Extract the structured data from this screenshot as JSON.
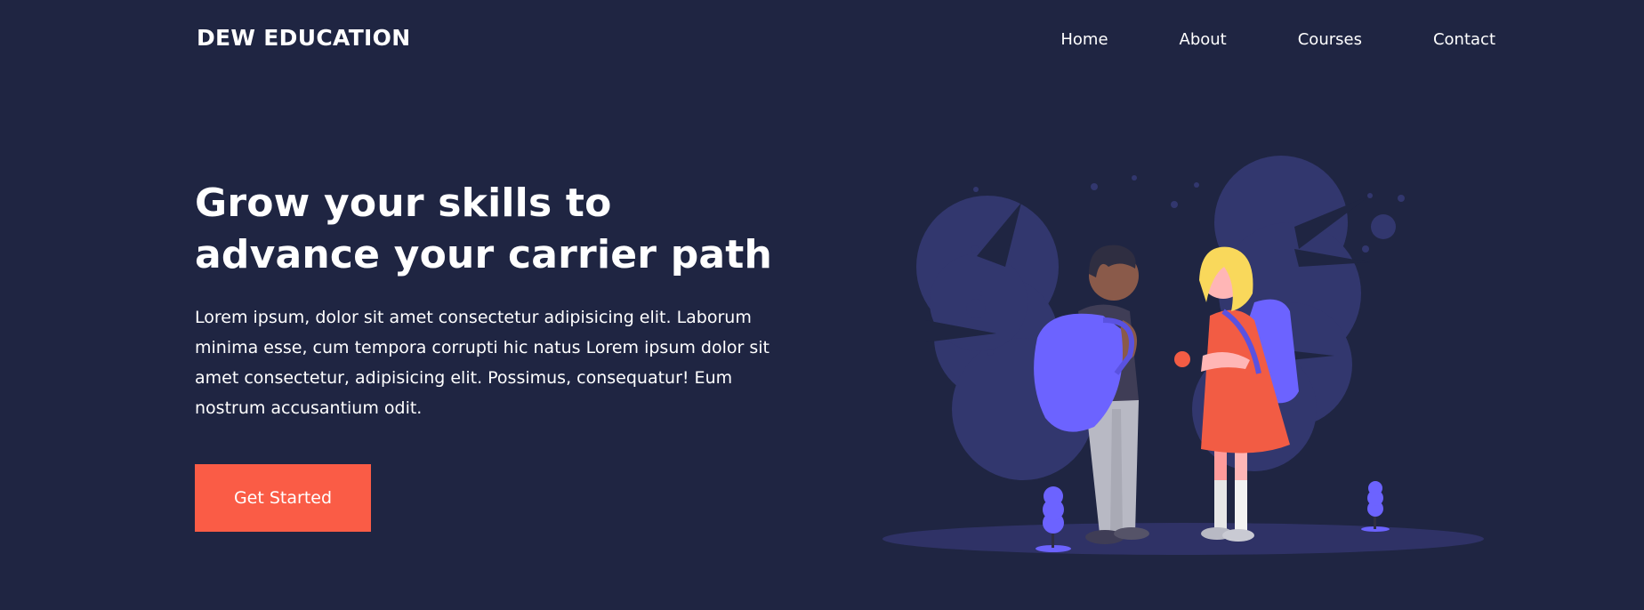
{
  "header": {
    "brand": "DEW EDUCATION",
    "nav": [
      {
        "label": "Home"
      },
      {
        "label": "About"
      },
      {
        "label": "Courses"
      },
      {
        "label": "Contact"
      }
    ]
  },
  "hero": {
    "title_line1": "Grow your skills to",
    "title_line2": "advance your carrier path",
    "description": "Lorem ipsum, dolor sit amet consectetur adipisicing elit. Laborum minima esse, cum tempora corrupti hic natus Lorem ipsum dolor sit amet consectetur, adipisicing elit. Possimus, consequatur! Eum nostrum accusantium odit.",
    "cta_label": "Get Started"
  },
  "illustration": {
    "icon": "students-with-backpacks-illustration"
  },
  "colors": {
    "background": "#1f2542",
    "accent": "#fa5c46",
    "illustration_purple": "#6c63ff",
    "illustration_shadow": "#2f3266"
  }
}
